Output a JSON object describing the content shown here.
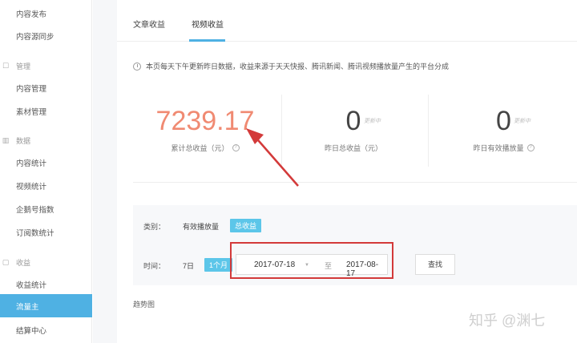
{
  "sidebar": {
    "items_top": [
      "内容发布",
      "内容源同步"
    ],
    "sections": [
      {
        "title": "管理",
        "items": [
          "内容管理",
          "素材管理"
        ]
      },
      {
        "title": "数据",
        "items": [
          "内容统计",
          "视频统计",
          "企鹅号指数",
          "订阅数统计"
        ]
      },
      {
        "title": "收益",
        "items": [
          "收益统计",
          "流量主",
          "结算中心"
        ]
      }
    ],
    "active_item": "流量主"
  },
  "tabs": [
    {
      "label": "文章收益",
      "active": false
    },
    {
      "label": "视频收益",
      "active": true
    }
  ],
  "notice": "本页每天下午更新昨日数据，收益来源于天天快报、腾讯新闻、腾讯视频播放量产生的平台分成",
  "stats": [
    {
      "value": "7239.17",
      "label": "累计总收益（元）",
      "updating": "",
      "color": "#f08a72"
    },
    {
      "value": "0",
      "label": "昨日总收益（元）",
      "updating": "更新中",
      "color": "#444444"
    },
    {
      "value": "0",
      "label": "昨日有效播放量",
      "updating": "更新中",
      "color": "#444444"
    }
  ],
  "filter": {
    "category_label": "类别：",
    "category_option": "有效播放量",
    "category_selected": "总收益",
    "time_label": "时间：",
    "time_option": "7日",
    "time_selected": "1个月",
    "date_start": "2017-07-18",
    "date_sep": "至",
    "date_end": "2017-08-17",
    "search_label": "查找"
  },
  "trend_label": "趋势图",
  "watermark": "知乎 @渊七",
  "colors": {
    "accent": "#4fb1e3",
    "highlight": "#d33a3a"
  }
}
